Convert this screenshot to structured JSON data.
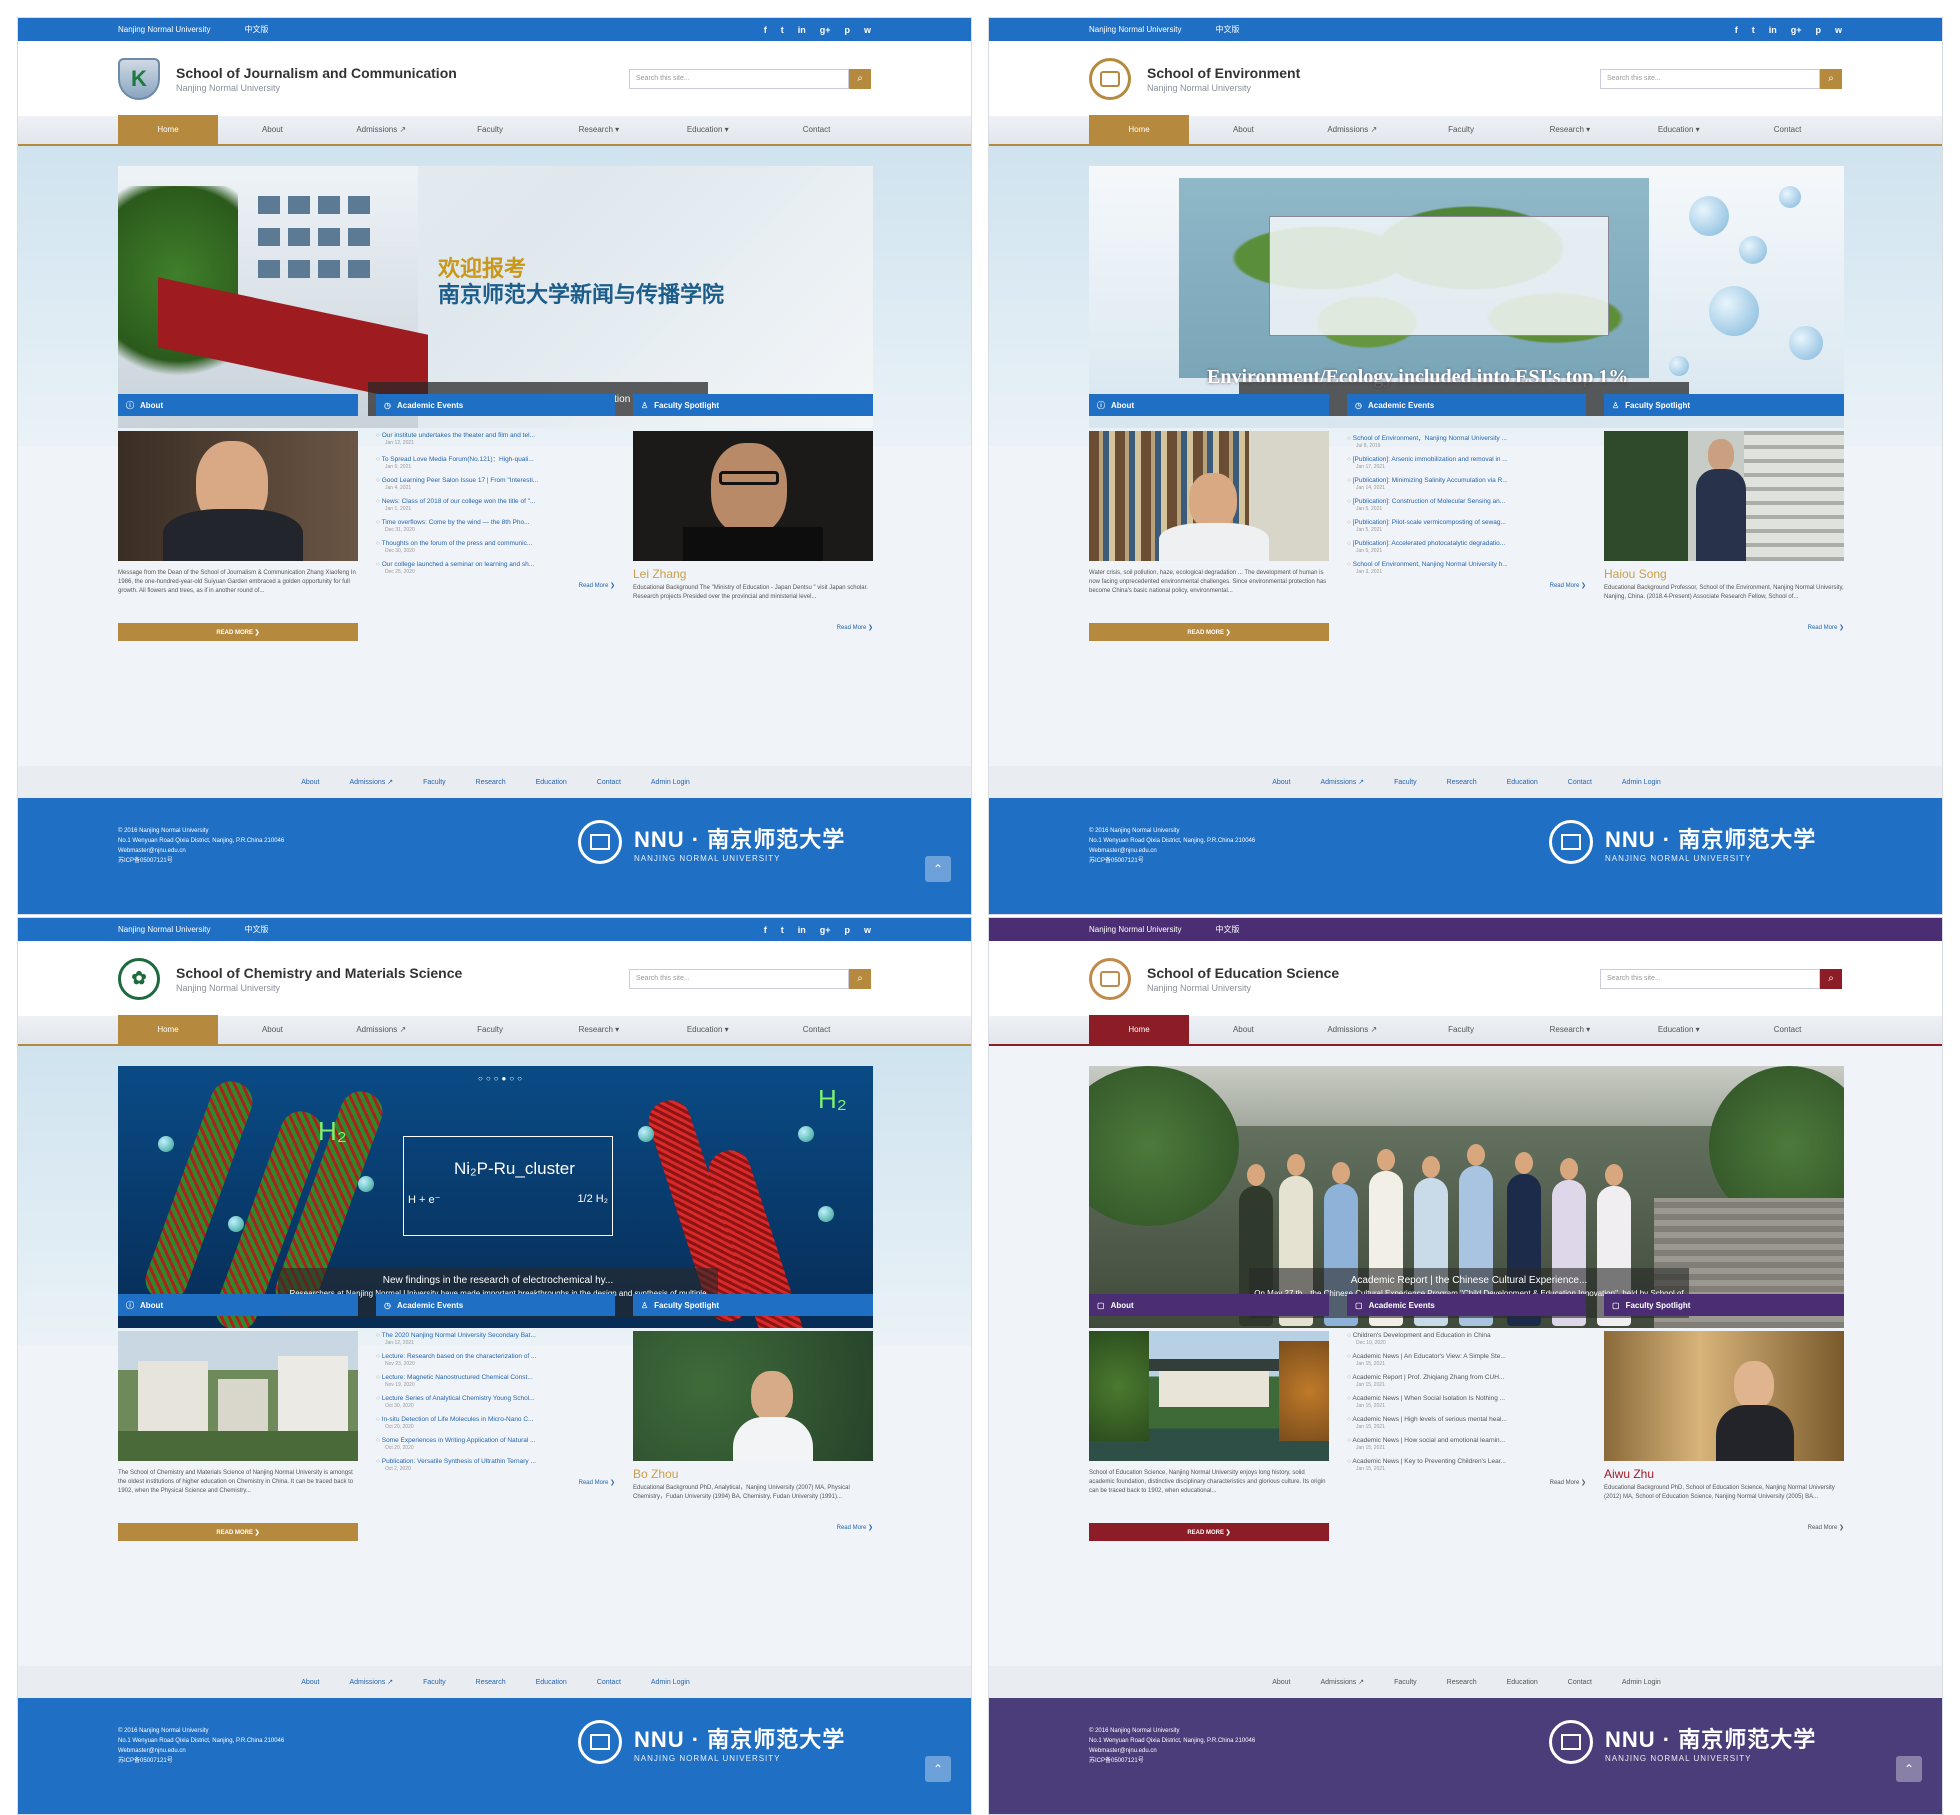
{
  "common": {
    "university": "Nanjing Normal University",
    "lang": "中文版",
    "search_placeholder": "Search this site...",
    "social_icons": [
      "f",
      "t",
      "in",
      "g+",
      "p",
      "w"
    ],
    "nav": [
      "Home",
      "About",
      "Admissions ↗",
      "Faculty",
      "Research ▾",
      "Education ▾",
      "Contact"
    ],
    "section_about": "About",
    "section_events": "Academic Events",
    "section_faculty": "Faculty Spotlight",
    "read_more_btn": "READ MORE ❯",
    "read_more_link": "Read More ❯",
    "footer_nav": [
      "About",
      "Admissions ↗",
      "Faculty",
      "Research",
      "Education",
      "Contact",
      "Admin Login"
    ],
    "footer_lines": [
      "© 2016 Nanjing Normal University",
      "No.1 Wenyuan Road Qixia District, Nanjing, P.R.China 210046",
      "Webmaster@njnu.edu.cn",
      "苏ICP备05007121号"
    ],
    "nnu_big": "NNU · 南京师范大学",
    "nnu_sub": "NANJING NORMAL UNIVERSITY",
    "totop": "⌃"
  },
  "sites": [
    {
      "title": "School of Journalism and Communication",
      "hero_cn1": "欢迎报考",
      "hero_cn2": "南京师范大学新闻与传播学院",
      "hero_caption": "School of Journalism and Communication",
      "about_text": "Message from the Dean of the School of Journalism & Communication Zhang Xiaofeng In 1986, the one-hundred-year-old Suiyuan Garden embraced a golden opportunity for full growth. All flowers and trees, as if in another round of...",
      "events": [
        {
          "t": "Our institute undertakes the theater and film and tel...",
          "d": "Jan 12, 2021"
        },
        {
          "t": "To Spread Love Media Forum(No.121)：High-quali...",
          "d": "Jan 6, 2021"
        },
        {
          "t": "Good Learning Peer Salon Issue 17 | From \"Interesti...",
          "d": "Jan 4, 2021"
        },
        {
          "t": "News: Class of 2018 of our college won the title of \"...",
          "d": "Jan 1, 2021"
        },
        {
          "t": "Time overflows: Come by the wind — the 8th Pho...",
          "d": "Dec 31, 2020"
        },
        {
          "t": "Thoughts on the forum of the press and communic...",
          "d": "Dec 30, 2020"
        },
        {
          "t": "Our college launched a seminar on learning and sh...",
          "d": "Dec 25, 2020"
        }
      ],
      "faculty_name": "Lei Zhang",
      "faculty_desc": "Educational Background The \"Ministry of Education - Japan Dentsu \" visit Japan scholar. Research projects Presided over the provincial and ministerial level..."
    },
    {
      "title": "School of Environment",
      "hero_big": "Environment/Ecology included into ESI's top 1%",
      "hero_caption": "Environment/Ecology included into ESI's top 1...",
      "about_text": "Water crisis, soil pollution, haze, ecological degradation ... The development of human is now facing unprecedented environmental challenges. Since environmental protection has become China's basic national policy, environmental...",
      "events": [
        {
          "t": "School of Environment，Nanjing Normal University ...",
          "d": "Jul 8, 2019"
        },
        {
          "t": "[Publication]: Arsenic immobilization and removal in ...",
          "d": "Jan 17, 2021"
        },
        {
          "t": "[Publication]: Minimizing Salinity Accumulation via R...",
          "d": "Jan 14, 2021"
        },
        {
          "t": "[Publication]: Construction of Molecular Sensing an...",
          "d": "Jan 5, 2021"
        },
        {
          "t": "[Publication]: Pilot-scale vermicomposting of sewag...",
          "d": "Jan 5, 2021"
        },
        {
          "t": "[Publication]: Accelerated photocatalytic degradatio...",
          "d": "Jan 5, 2021"
        },
        {
          "t": "School of Environment, Nanjing Normal University h...",
          "d": "Jan 3, 2021"
        }
      ],
      "faculty_name": "Haiou Song",
      "faculty_desc": "Educational Background Professor, School of the Environment, Nanjing Normal University, Nanjing, China. (2018.4-Present) Associate Research Fellow, School of..."
    },
    {
      "title": "School of Chemistry and Materials Science",
      "hero_graph_label": "Ni₂P-Ru_cluster",
      "hero_caption_title": "New findings in the research of electrochemical hy...",
      "hero_caption": "Researchers at Nanjing Normal University have made important breakthroughs in the design and synthesis of multiple heterogeneous nanostructures and their...",
      "about_text": "The School of Chemistry and Materials Science of Nanjing Normal University is amongst the oldest institutions of higher education on Chemistry in China. It can be traced back to 1902, when the Physical Science and Chemistry...",
      "events": [
        {
          "t": "The 2020 Nanjing Normal University Secondary Bat...",
          "d": "Jan 12, 2021"
        },
        {
          "t": "Lecture: Research based on the characterization of ...",
          "d": "Nov 23, 2020"
        },
        {
          "t": "Lecture: Magnetic Nanostructured Chemical Const...",
          "d": "Nov 19, 2020"
        },
        {
          "t": "Lecture Series of Analytical Chemistry Young Schol...",
          "d": "Oct 30, 2020"
        },
        {
          "t": "In-situ Detection of Life Molecules in Micro-Nano C...",
          "d": "Oct 20, 2020"
        },
        {
          "t": "Some Experiences in Writing Application of Natural ...",
          "d": "Oct 20, 2020"
        },
        {
          "t": "Publication: Versatile Synthesis of Ultrathin Ternary ...",
          "d": "Oct 2, 2020"
        }
      ],
      "faculty_name": "Bo Zhou",
      "faculty_desc": "Educational Background PhD, Analytical，Nanjing University (2007) MA, Physical Chemistry，Fudan University (1994) BA, Chemistry, Fudan University (1991)..."
    },
    {
      "title": "School of Education Science",
      "hero_caption_title": "Academic Report | the Chinese Cultural Experience...",
      "hero_caption": "On May 27 th，the Chinese Cultural Experience Program \"Child Development & Education Innovation\", held by School of Education Science, held...",
      "about_text": "School of Education Science, Nanjing Normal University enjoys long history, solid academic foundation, distinctive disciplinary characteristics and glorious culture. Its origin can be traced back to 1902, when educational...",
      "events": [
        {
          "t": "Children's Development and Education in China",
          "d": "Dec 10, 2020"
        },
        {
          "t": "Academic News | An Educator's View: A Simple Ste...",
          "d": "Jan 15, 2021"
        },
        {
          "t": "Academic Report | Prof. Zhiqiang Zhang from CUH...",
          "d": "Jan 15, 2021"
        },
        {
          "t": "Academic News | When Social Isolation Is Nothing ...",
          "d": "Jan 15, 2021"
        },
        {
          "t": "Academic News | High levels of serious mental heal...",
          "d": "Jan 15, 2021"
        },
        {
          "t": "Academic News | How social and emotional learnin...",
          "d": "Jan 15, 2021"
        },
        {
          "t": "Academic News | Key to Preventing Children's Lear...",
          "d": "Jan 15, 2021"
        }
      ],
      "faculty_name": "Aiwu Zhu",
      "faculty_desc": "Educational Background PhD, School of Education Science, Nanjing Normal University (2012) MA, School of Education Science, Nanjing Normal University (2005) BA..."
    }
  ],
  "colors": {
    "blue": "#1f6fc5",
    "gold": "#b68a3e",
    "purple": "#4b2d73",
    "maroon": "#8c1d26"
  }
}
